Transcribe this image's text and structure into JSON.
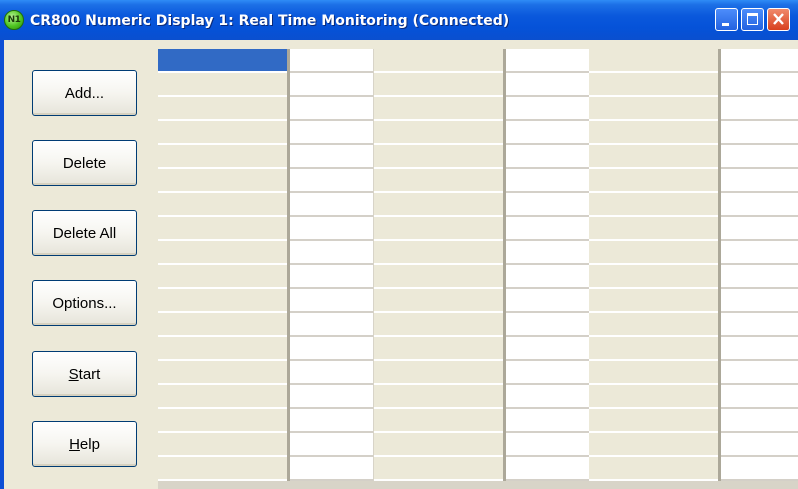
{
  "window": {
    "title": "CR800 Numeric Display 1: Real Time Monitoring (Connected)",
    "app_icon_text": "N1",
    "icons": [
      "app-icon",
      "minimize-icon",
      "maximize-icon",
      "close-icon"
    ]
  },
  "buttons": {
    "add": "Add...",
    "delete": "Delete",
    "delete_all": "Delete All",
    "options": "Options...",
    "start": "Start",
    "help": "Help",
    "start_mnemonic": "S",
    "help_mnemonic": "H"
  },
  "grid": {
    "column_groups": 3,
    "rows": 18,
    "selected_cell": "row 1, group 1 label",
    "label_cells": [
      "",
      "",
      ""
    ],
    "value_cells": [
      "",
      "",
      ""
    ]
  },
  "colors": {
    "titlebar": "#0a58dc",
    "selection": "#316ac5",
    "face": "#ece9d8",
    "close": "#d8401e"
  }
}
